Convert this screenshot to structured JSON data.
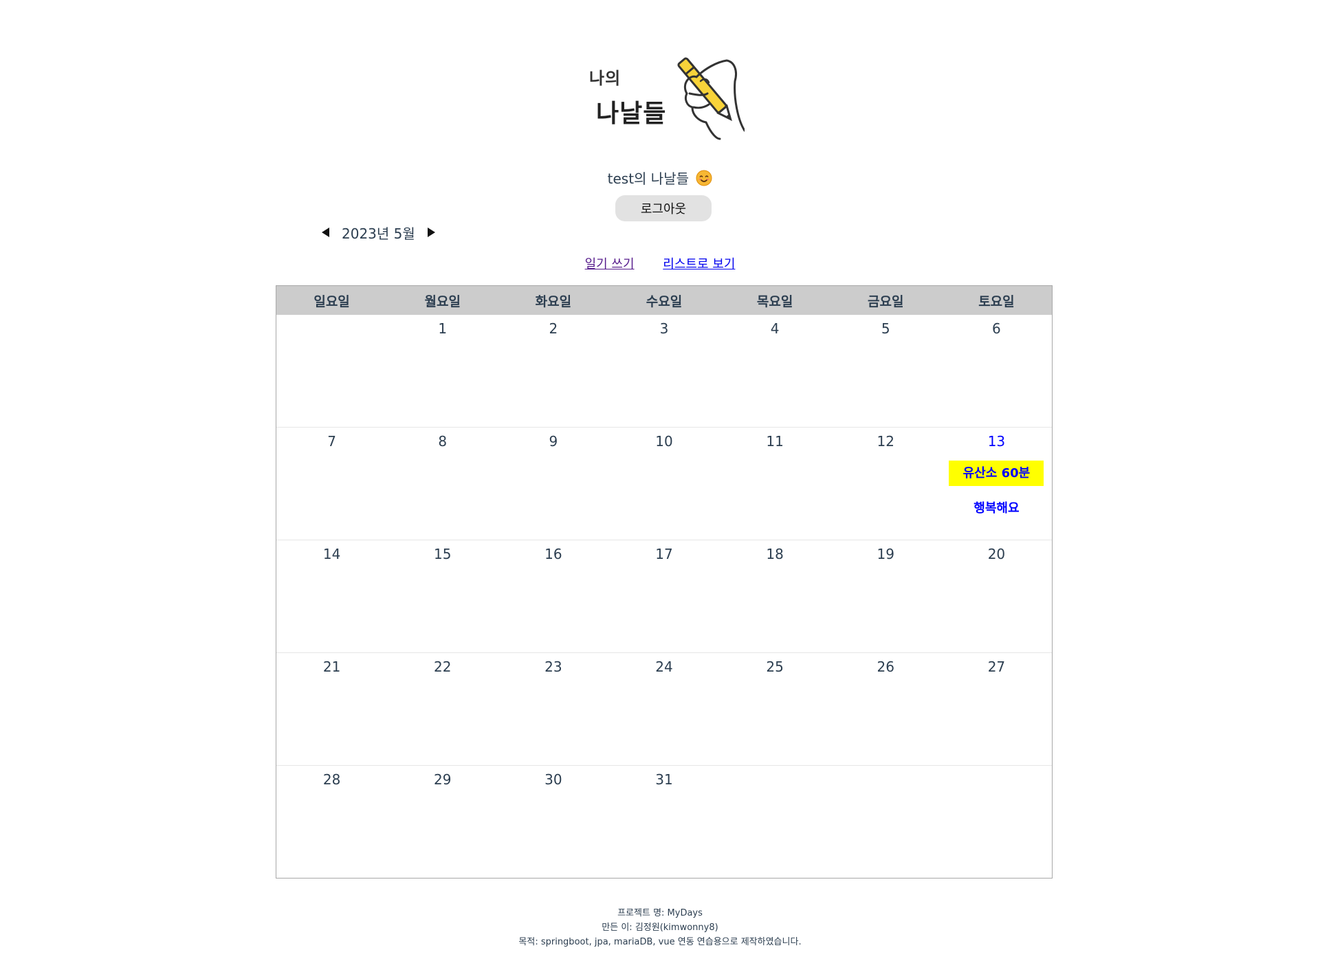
{
  "logo": {
    "line1": "나의",
    "line2": "나날들",
    "icon": "hand-writing-pencil-icon"
  },
  "greeting": {
    "text": "test의 나날들",
    "emoji_icon": "smiling-face-emoji-icon"
  },
  "logout_label": "로그아웃",
  "month_nav": {
    "label": "2023년 5월",
    "prev_icon": "triangle-left-icon",
    "next_icon": "triangle-right-icon"
  },
  "links": {
    "write": "일기 쓰기",
    "list": "리스트로 보기"
  },
  "calendar": {
    "weekdays": [
      "일요일",
      "월요일",
      "화요일",
      "수요일",
      "목요일",
      "금요일",
      "토요일"
    ],
    "weeks": [
      [
        "",
        "1",
        "2",
        "3",
        "4",
        "5",
        "6"
      ],
      [
        "7",
        "8",
        "9",
        "10",
        "11",
        "12",
        "13"
      ],
      [
        "14",
        "15",
        "16",
        "17",
        "18",
        "19",
        "20"
      ],
      [
        "21",
        "22",
        "23",
        "24",
        "25",
        "26",
        "27"
      ],
      [
        "28",
        "29",
        "30",
        "31",
        "",
        "",
        ""
      ]
    ],
    "entry": {
      "day": "13",
      "badge": "유산소 60분",
      "text": "행복해요"
    }
  },
  "footer": {
    "line1": "프로젝트 명: MyDays",
    "line2": "만든 이: 김정원(kimwonny8)",
    "line3": "목적: springboot, jpa, mariaDB, vue 연동 연습용으로 제작하였습니다."
  },
  "colors": {
    "header_bg": "#cccccc",
    "badge_bg": "#ffff00",
    "entry_text": "#0000ff",
    "logout_bg": "#e2e2e2"
  }
}
